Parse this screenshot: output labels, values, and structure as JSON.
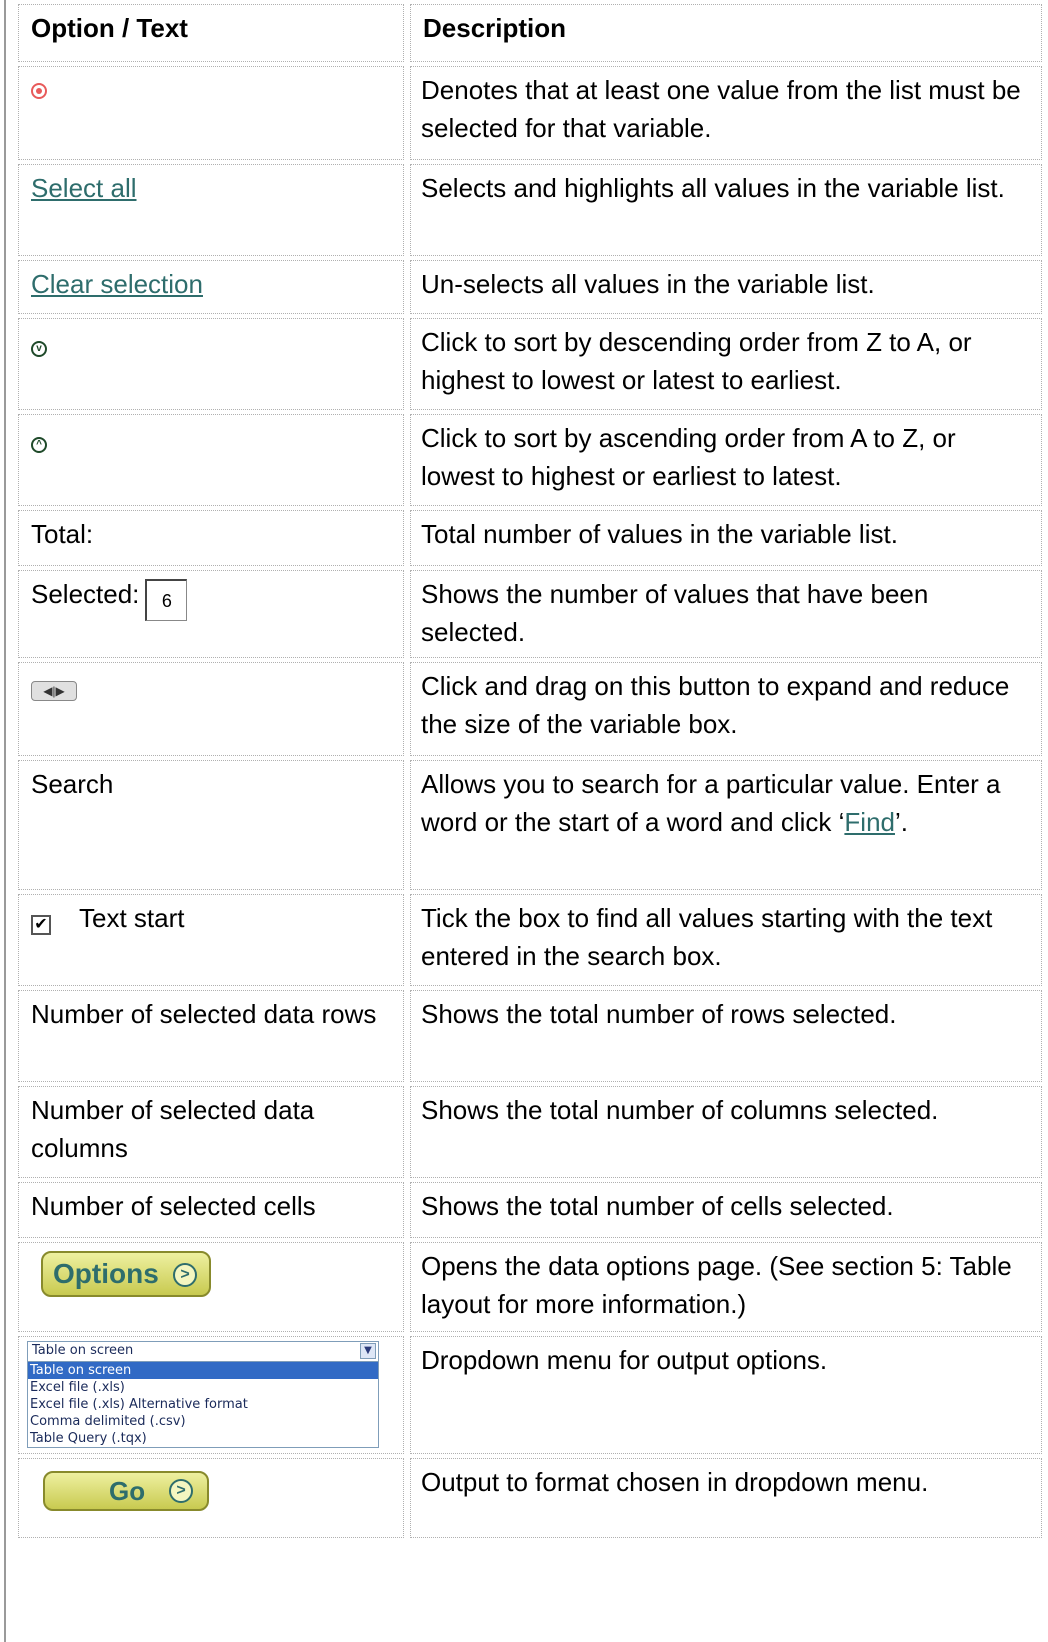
{
  "header": {
    "col1": "Option / Text",
    "col2": "Description"
  },
  "rows": [
    {
      "option": "",
      "icon": "required-dot-icon",
      "desc": "Denotes that at least one value from the list must be selected for that variable."
    },
    {
      "option": "Select all",
      "desc": "Selects and highlights all values in the variable list."
    },
    {
      "option": "Clear selection",
      "desc": "Un-selects all values in the variable list."
    },
    {
      "option": "",
      "icon": "sort-descending-icon",
      "desc": "Click to sort by descending order from Z to A, or highest to lowest or latest to earliest."
    },
    {
      "option": "",
      "icon": "sort-ascending-icon",
      "desc": "Click to sort by ascending order from A to Z, or lowest to highest or earliest to latest."
    },
    {
      "option": "Total:",
      "desc": "Total number of values in the variable list."
    },
    {
      "option": "Selected:",
      "value": "6",
      "desc": "Shows the number of values that have been selected."
    },
    {
      "option": "",
      "icon": "resize-handle-icon",
      "desc": "Click and drag on this button to expand and reduce the size of the variable box."
    },
    {
      "option": "Search",
      "desc_pre": "Allows you to search for a particular value. Enter a word or the start of a word and click ‘",
      "desc_link": "Find",
      "desc_post": "’."
    },
    {
      "option": "Text start",
      "checked": true,
      "desc": "Tick the box to find all values starting with the text entered in the search box."
    },
    {
      "option": "Number of selected data rows",
      "desc": "Shows the total number of rows selected."
    },
    {
      "option": "Number of selected data columns",
      "desc": "Shows the total number of columns selected."
    },
    {
      "option": "Number of selected cells",
      "desc": "Shows the total number of cells selected."
    },
    {
      "option": "Options",
      "desc": "Opens the data options page. (See section 5: Table layout for more information.)"
    },
    {
      "dropdown": {
        "selected": "Table on screen",
        "options": [
          "Table on screen",
          "Excel file (.xls)",
          "Excel file (.xls) Alternative format",
          "Comma delimited (.csv)",
          "Table Query (.tqx)"
        ]
      },
      "desc": "Dropdown menu for output options."
    },
    {
      "option": "Go",
      "desc": "Output to format chosen in dropdown menu."
    }
  ],
  "colors": {
    "link": "#2e6d6c",
    "button_fill": "#e6e88c",
    "required": "#e85a5a"
  }
}
